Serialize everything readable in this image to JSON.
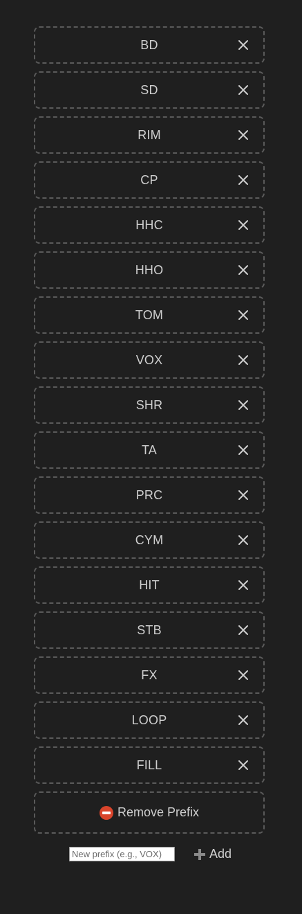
{
  "prefixes": [
    {
      "label": "BD"
    },
    {
      "label": "SD"
    },
    {
      "label": "RIM"
    },
    {
      "label": "CP"
    },
    {
      "label": "HHC"
    },
    {
      "label": "HHO"
    },
    {
      "label": "TOM"
    },
    {
      "label": "VOX"
    },
    {
      "label": "SHR"
    },
    {
      "label": "TA"
    },
    {
      "label": "PRC"
    },
    {
      "label": "CYM"
    },
    {
      "label": "HIT"
    },
    {
      "label": "STB"
    },
    {
      "label": "FX"
    },
    {
      "label": "LOOP"
    },
    {
      "label": "FILL"
    }
  ],
  "remove_prefix": {
    "label": "Remove Prefix",
    "icon": "no-entry-icon"
  },
  "new_prefix": {
    "value": "",
    "placeholder": "New prefix (e.g., VOX)"
  },
  "add_button": {
    "label": "Add",
    "icon": "plus-icon"
  },
  "colors": {
    "background": "#1f1f1f",
    "text": "#cfcfcf",
    "border": "#5a5a5a",
    "remove_icon": "#d9442b"
  }
}
